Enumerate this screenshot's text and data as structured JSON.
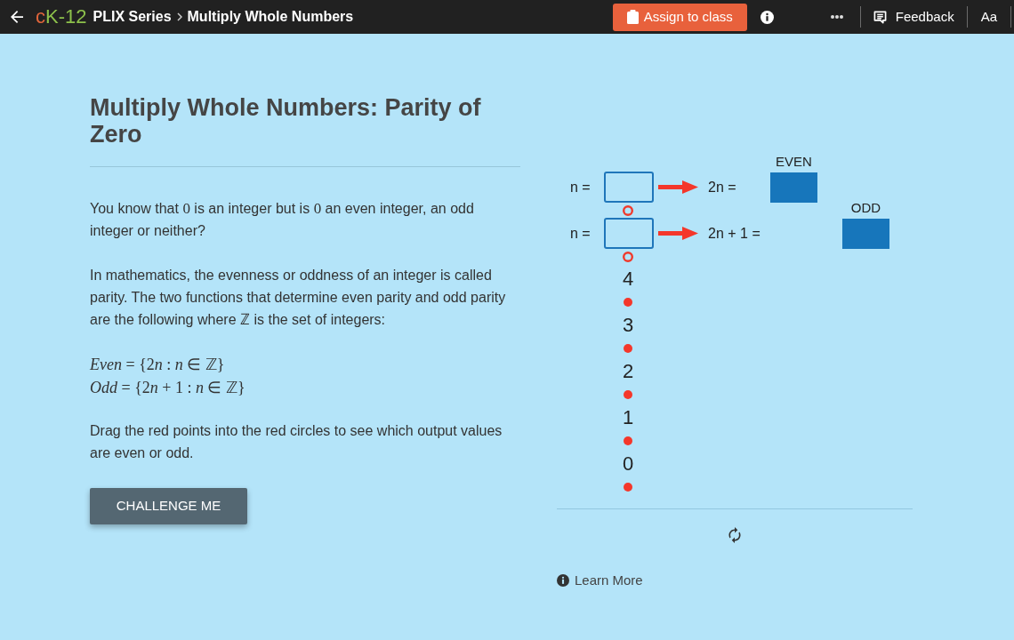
{
  "top_bar": {
    "logo": [
      "c",
      "K-12"
    ],
    "breadcrumbs": [
      {
        "label": "PLIX Series"
      },
      {
        "label": "Multiply Whole Numbers"
      }
    ],
    "assign_button": {
      "label": "Assign to class"
    },
    "feedback_button": {
      "label": "Feedback"
    },
    "text_size_button": {
      "label": "Aa"
    }
  },
  "lesson": {
    "title": "Multiply Whole Numbers: Parity of Zero",
    "paragraphs": [
      {
        "parts": [
          {
            "kind": "text",
            "text": "You know that "
          },
          {
            "kind": "math",
            "text": "0"
          },
          {
            "kind": "text",
            "text": " is an integer but is "
          },
          {
            "kind": "math",
            "text": "0"
          },
          {
            "kind": "text",
            "text": " an even integer, an odd integer or neither?"
          }
        ]
      },
      {
        "parts": [
          {
            "kind": "text",
            "text": "In mathematics, the evenness or oddness of an integer is called parity. The two functions that determine even parity and odd parity are the following where "
          },
          {
            "kind": "math",
            "text": "ℤ"
          },
          {
            "kind": "text",
            "text": " is the set of integers:"
          }
        ]
      }
    ],
    "formulas": [
      {
        "parts": [
          {
            "kind": "italic",
            "text": "Even"
          },
          {
            "kind": "text",
            "text": " = {2"
          },
          {
            "kind": "italic",
            "text": "n"
          },
          {
            "kind": "text",
            "text": " : "
          },
          {
            "kind": "italic",
            "text": "n"
          },
          {
            "kind": "text",
            "text": " ∈ ℤ}"
          }
        ]
      },
      {
        "parts": [
          {
            "kind": "italic",
            "text": "Odd"
          },
          {
            "kind": "text",
            "text": " = {2"
          },
          {
            "kind": "italic",
            "text": "n"
          },
          {
            "kind": "text",
            "text": " + 1 : "
          },
          {
            "kind": "italic",
            "text": "n"
          },
          {
            "kind": "text",
            "text": " ∈ ℤ}"
          }
        ]
      }
    ],
    "instruction": "Drag the red points into the red circles to see which output values are even or odd.",
    "challenge_button": {
      "label": "CHALLENGE ME"
    }
  },
  "applet": {
    "rows": [
      {
        "input_label": "n =",
        "expression": "2n =",
        "result_label": "EVEN"
      },
      {
        "input_label": "n =",
        "expression": "2n + 1 =",
        "result_label": "ODD"
      }
    ],
    "number_line": [
      "4",
      "3",
      "2",
      "1",
      "0"
    ]
  },
  "learn_more": {
    "label": "Learn More"
  }
}
